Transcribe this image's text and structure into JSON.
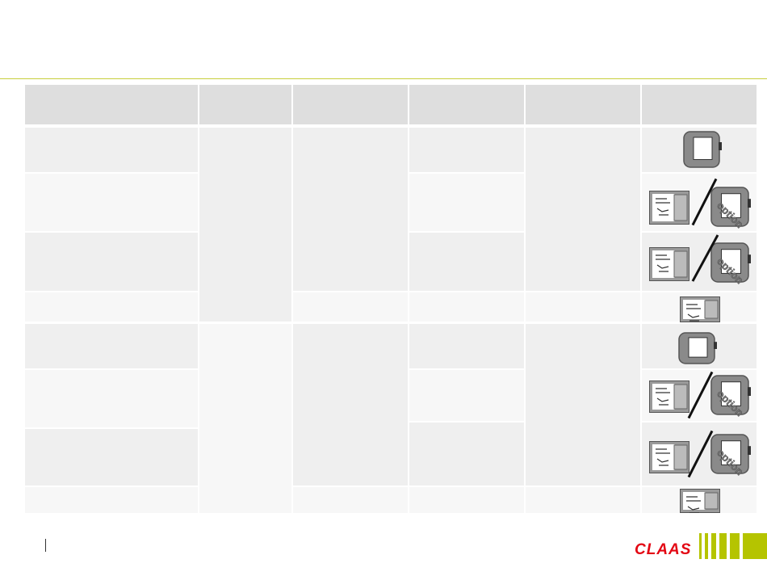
{
  "slide": {
    "title": "",
    "page_number": ""
  },
  "table": {
    "headers": [
      "",
      "",
      "",
      "",
      "",
      ""
    ],
    "rows": [
      {
        "label": "",
        "screen": "terminal"
      },
      {
        "label": "",
        "screen": "panel-or-terminal-option"
      },
      {
        "label": "",
        "screen": "panel-or-terminal-option"
      },
      {
        "label": "",
        "screen": "panel"
      },
      {
        "label": "",
        "screen": "terminal"
      },
      {
        "label": "",
        "screen": "panel-or-terminal-option"
      },
      {
        "label": "",
        "screen": "panel-or-terminal-option"
      },
      {
        "label": "",
        "screen": "panel"
      }
    ],
    "overlay_text": "option"
  },
  "brand": {
    "logo_text": "CLAAS",
    "logo_color": "#e30613",
    "accent_color": "#b5c400"
  }
}
